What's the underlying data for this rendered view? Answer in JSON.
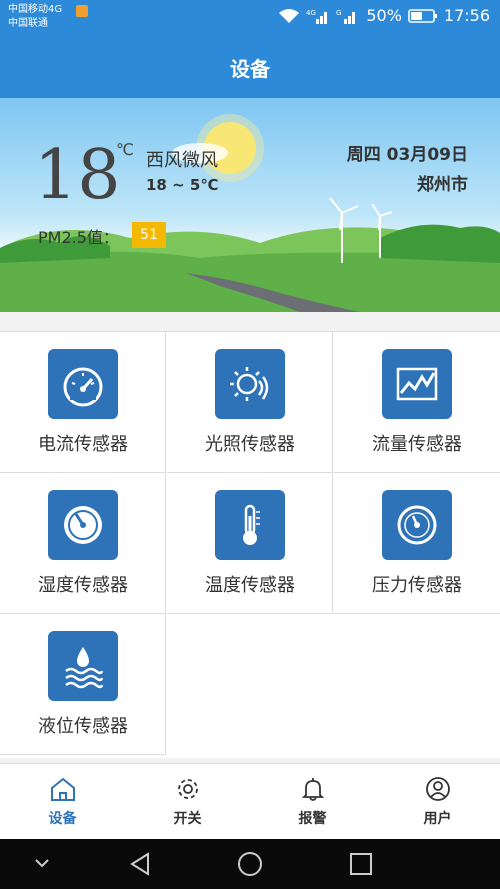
{
  "status_bar": {
    "carrier1": "中国移动4G",
    "carrier2": "中国联通",
    "battery": "50%",
    "time": "17:56"
  },
  "app_bar": {
    "title": "设备"
  },
  "weather": {
    "temperature": "18",
    "unit": "℃",
    "wind": "西风微风",
    "range": "18 ~ 5℃",
    "date": "周四 03月09日",
    "city": "郑州市",
    "pm_label": "PM2.5值：",
    "pm_value": "51",
    "pm_color": "#f5b800"
  },
  "sensors": [
    {
      "label": "电流传感器",
      "icon": "gauge-icon"
    },
    {
      "label": "光照传感器",
      "icon": "sun-icon"
    },
    {
      "label": "流量传感器",
      "icon": "line-chart-icon"
    },
    {
      "label": "湿度传感器",
      "icon": "dial-icon"
    },
    {
      "label": "温度传感器",
      "icon": "thermometer-icon"
    },
    {
      "label": "压力传感器",
      "icon": "pressure-gauge-icon"
    },
    {
      "label": "液位传感器",
      "icon": "water-level-icon"
    }
  ],
  "bottom_nav": [
    {
      "label": "设备",
      "icon": "home-icon",
      "active": true
    },
    {
      "label": "开关",
      "icon": "gear-icon",
      "active": false
    },
    {
      "label": "报警",
      "icon": "bell-icon",
      "active": false
    },
    {
      "label": "用户",
      "icon": "user-icon",
      "active": false
    }
  ],
  "colors": {
    "primary": "#2c8ad8",
    "icon_bg": "#2e72b8"
  }
}
